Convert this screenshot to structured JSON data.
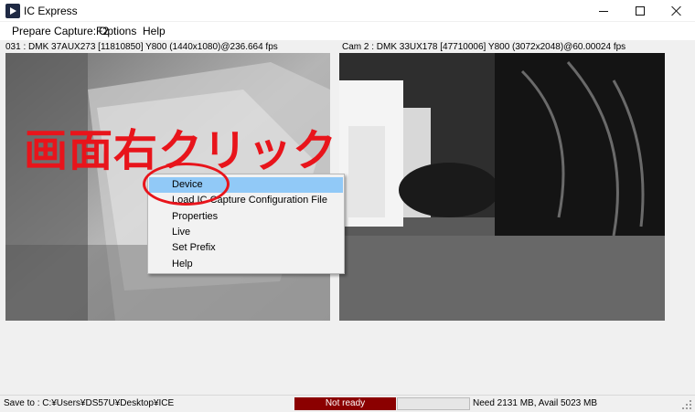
{
  "window": {
    "title": "IC Express",
    "controls": [
      "minimize-icon",
      "maximize-icon",
      "close-icon"
    ]
  },
  "menubar": {
    "items": [
      "Prepare Capture:F2",
      "Options",
      "Help"
    ]
  },
  "cameras": [
    {
      "label": "031 : DMK 37AUX273 [11810850] Y800 (1440x1080)@236.664 fps"
    },
    {
      "label": "Cam 2 : DMK 33UX178 [47710006] Y800 (3072x2048)@60.00024 fps"
    }
  ],
  "annotation": {
    "text": "画面右クリック",
    "color": "#e8141b"
  },
  "context_menu": {
    "selected_index": 0,
    "items": [
      {
        "label": "Device"
      },
      {
        "label": "Load IC Capture Configuration File"
      },
      {
        "label": "Properties"
      },
      {
        "label": "Live"
      },
      {
        "label": "Set Prefix"
      },
      {
        "label": "Help"
      }
    ]
  },
  "statusbar": {
    "save_to": "Save to : C:¥Users¥DS57U¥Desktop¥ICE",
    "status": "Not ready",
    "status_color": "#8b0000",
    "storage": "Need 2131 MB, Avail 5023 MB"
  }
}
